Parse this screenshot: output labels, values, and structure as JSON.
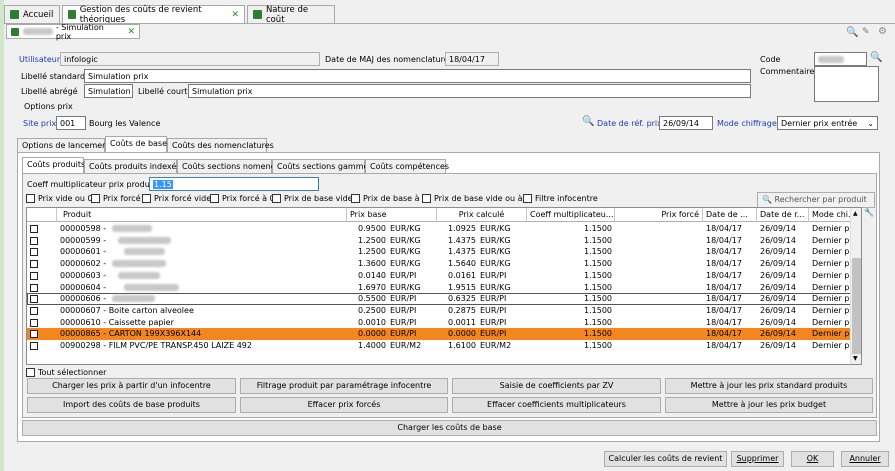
{
  "tabs": [
    {
      "label": "Accueil",
      "closable": false
    },
    {
      "label": "Gestion des coûts de revient théoriques",
      "closable": true
    },
    {
      "label": "Nature de coût",
      "closable": false
    }
  ],
  "subwindow": {
    "title": "- Simulation prix",
    "close": "✕"
  },
  "form": {
    "utilisateur_label": "Utilisateur",
    "utilisateur_value": "infologic",
    "date_maj_label": "Date de MAJ des nomenclatures",
    "date_maj_value": "18/04/17",
    "code_label": "Code",
    "commentaire_label": "Commentaire",
    "libelle_standard_label": "Libellé standard",
    "libelle_standard_value": "Simulation prix",
    "libelle_abrege_label": "Libellé abrégé",
    "libelle_abrege_value": "Simulation",
    "libelle_court_label": "Libellé court",
    "libelle_court_value": "Simulation prix",
    "options_prix_label": "Options prix",
    "site_prix_label": "Site prix",
    "site_prix_code": "001",
    "site_prix_name": "Bourg les Valence",
    "date_ref_label": "Date de réf. prix",
    "date_ref_value": "26/09/14",
    "mode_chiffrage_label": "Mode chiffrage",
    "mode_chiffrage_value": "Dernier prix entrée"
  },
  "main_tabs": [
    "Options de lancement",
    "Coûts de base",
    "Coûts des nomenclatures"
  ],
  "inner_tabs": [
    "Coûts produits",
    "Coûts produits indexés",
    "Coûts sections nomenc",
    "Coûts sections gamme",
    "Coûts compétences"
  ],
  "coeff": {
    "label": "Coeff multiplicateur prix produit",
    "value": "1.15"
  },
  "filters": [
    "Prix vide ou 0",
    "Prix forcé",
    "Prix forcé vide",
    "Prix forcé à 0",
    "Prix de base vide",
    "Prix de base à 0",
    "Prix de base vide ou à 0",
    "Filtre infocentre"
  ],
  "search_button": "Rechercher par produit",
  "columns": [
    "Produit",
    "Prix base",
    "Prix calculé",
    "Coeff multiplicateu...",
    "Prix forcé",
    "Date de ...",
    "Date de r...",
    "Mode chi..."
  ],
  "rows": [
    {
      "produit": "00000598 -",
      "prix_base": "0.9500",
      "u1": "EUR/KG",
      "prix_calc": "1.0925",
      "u2": "EUR/KG",
      "coeff": "1.1500",
      "d1": "18/04/17",
      "d2": "26/09/14",
      "mode": "Dernier pri..."
    },
    {
      "produit": "00000599 -",
      "prix_base": "1.2500",
      "u1": "EUR/KG",
      "prix_calc": "1.4375",
      "u2": "EUR/KG",
      "coeff": "1.1500",
      "d1": "18/04/17",
      "d2": "26/09/14",
      "mode": "Dernier pri..."
    },
    {
      "produit": "00000601 -",
      "prix_base": "1.2500",
      "u1": "EUR/KG",
      "prix_calc": "1.4375",
      "u2": "EUR/KG",
      "coeff": "1.1500",
      "d1": "18/04/17",
      "d2": "26/09/14",
      "mode": "Dernier pri..."
    },
    {
      "produit": "00000602 -",
      "prix_base": "1.3600",
      "u1": "EUR/KG",
      "prix_calc": "1.5640",
      "u2": "EUR/KG",
      "coeff": "1.1500",
      "d1": "18/04/17",
      "d2": "26/09/14",
      "mode": "Dernier pri..."
    },
    {
      "produit": "00000603 -",
      "prix_base": "0.0140",
      "u1": "EUR/PI",
      "prix_calc": "0.0161",
      "u2": "EUR/PI",
      "coeff": "1.1500",
      "d1": "18/04/17",
      "d2": "26/09/14",
      "mode": "Dernier pri..."
    },
    {
      "produit": "00000604 -",
      "prix_base": "1.6970",
      "u1": "EUR/KG",
      "prix_calc": "1.9515",
      "u2": "EUR/KG",
      "coeff": "1.1500",
      "d1": "18/04/17",
      "d2": "26/09/14",
      "mode": "Dernier pri..."
    },
    {
      "produit": "00000606 -",
      "prix_base": "0.5500",
      "u1": "EUR/PI",
      "prix_calc": "0.6325",
      "u2": "EUR/PI",
      "coeff": "1.1500",
      "d1": "18/04/17",
      "d2": "26/09/14",
      "mode": "Dernier pri..."
    },
    {
      "produit": "00000607 - Boite carton alveolee",
      "prix_base": "0.2500",
      "u1": "EUR/PI",
      "prix_calc": "0.2875",
      "u2": "EUR/PI",
      "coeff": "1.1500",
      "d1": "18/04/17",
      "d2": "26/09/14",
      "mode": "Dernier pri..."
    },
    {
      "produit": "00000610 - Caissette papier",
      "prix_base": "0.0010",
      "u1": "EUR/PI",
      "prix_calc": "0.0011",
      "u2": "EUR/PI",
      "coeff": "1.1500",
      "d1": "18/04/17",
      "d2": "26/09/14",
      "mode": "Dernier pri..."
    },
    {
      "produit": "00000865 - CARTON 199X396X144",
      "prix_base": "0.0000",
      "u1": "EUR/PI",
      "prix_calc": "0.0000",
      "u2": "EUR/PI",
      "coeff": "1.1500",
      "d1": "18/04/17",
      "d2": "26/09/14",
      "mode": "Dernier pri..."
    },
    {
      "produit": "00900298 - FILM PVC/PE TRANSP.450 LAIZE 492",
      "prix_base": "1.4000",
      "u1": "EUR/M2",
      "prix_calc": "1.6100",
      "u2": "EUR/M2",
      "coeff": "1.1500",
      "d1": "18/04/17",
      "d2": "26/09/14",
      "mode": "Dernier pri..."
    }
  ],
  "select_all": "Tout sélectionner",
  "buttons": [
    "Charger les prix à partir d'un infocentre",
    "Filtrage produit par paramétrage infocentre",
    "Saisie de coefficients par ZV",
    "Mettre à jour les prix standard produits",
    "Import des coûts de base produits",
    "Effacer prix forcés",
    "Effacer coefficients multiplicateurs",
    "Mettre à jour les prix budget"
  ],
  "load_button": "Charger les coûts de base",
  "bottom": {
    "calc": "Calculer les coûts de revient",
    "delete": "Supprimer",
    "ok": "OK",
    "cancel": "Annuler"
  },
  "colors": {
    "selected_row": "#f3871d",
    "accent_green": "#2f7d32",
    "link_blue": "#1a3fb3"
  }
}
